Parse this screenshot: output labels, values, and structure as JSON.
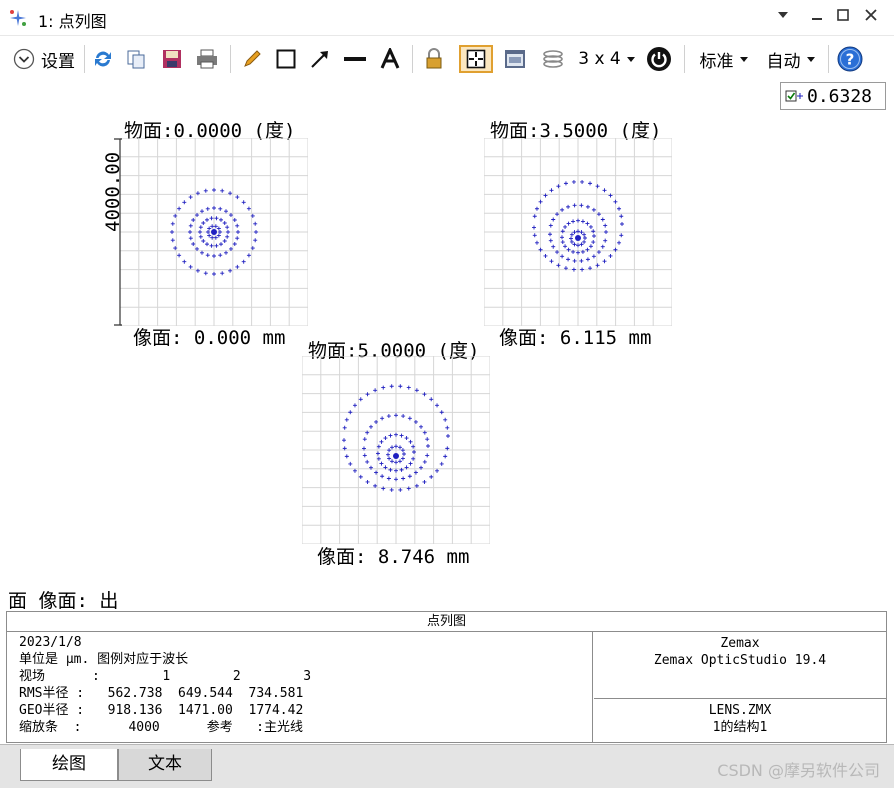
{
  "window": {
    "title": "1: 点列图",
    "controls": [
      "chevron-down-icon",
      "minimize-icon",
      "maximize-icon",
      "close-icon"
    ]
  },
  "toolbar": {
    "settings_label": "设置",
    "layout_label": "3 x 4",
    "standard_label": "标准",
    "auto_label": "自动",
    "icons": [
      "refresh-icon",
      "copy-icon",
      "save-icon",
      "print-icon",
      "pencil-icon",
      "rectangle-icon",
      "arrow-icon",
      "line-icon",
      "text-icon",
      "lock-icon",
      "crosshair-icon",
      "window-icon",
      "layers-icon",
      "power-icon",
      "help-icon"
    ]
  },
  "wavelength": "0.6328",
  "scale_label": "4000.00",
  "plots": [
    {
      "title": "物面:0.0000 (度)",
      "image_label": "像面: 0.000 mm"
    },
    {
      "title": "物面:3.5000 (度)",
      "image_label": "像面: 6.115 mm"
    },
    {
      "title": "物面:5.0000 (度)",
      "image_label": "像面: 8.746 mm"
    }
  ],
  "status_line": "面 像面: 出",
  "info": {
    "header": "点列图",
    "left_lines": [
      "2023/1/8",
      "单位是 μm. 图例对应于波长",
      "视场      :        1        2        3",
      "RMS半径 :   562.738  649.544  734.581",
      "GEO半径 :   918.136  1471.00  1774.42",
      "缩放条  :      4000      参考   :主光线"
    ],
    "right_top": [
      "Zemax",
      "Zemax OpticStudio 19.4"
    ],
    "right_bottom": [
      "LENS.ZMX",
      "1的结构1"
    ]
  },
  "tabs": [
    "绘图",
    "文本"
  ],
  "watermark": "CSDN @摩另软件公司",
  "colors": {
    "spot": "#2020c0",
    "grid": "#d6d6d6",
    "accent": "#e0a030",
    "help": "#2a6fd6"
  }
}
